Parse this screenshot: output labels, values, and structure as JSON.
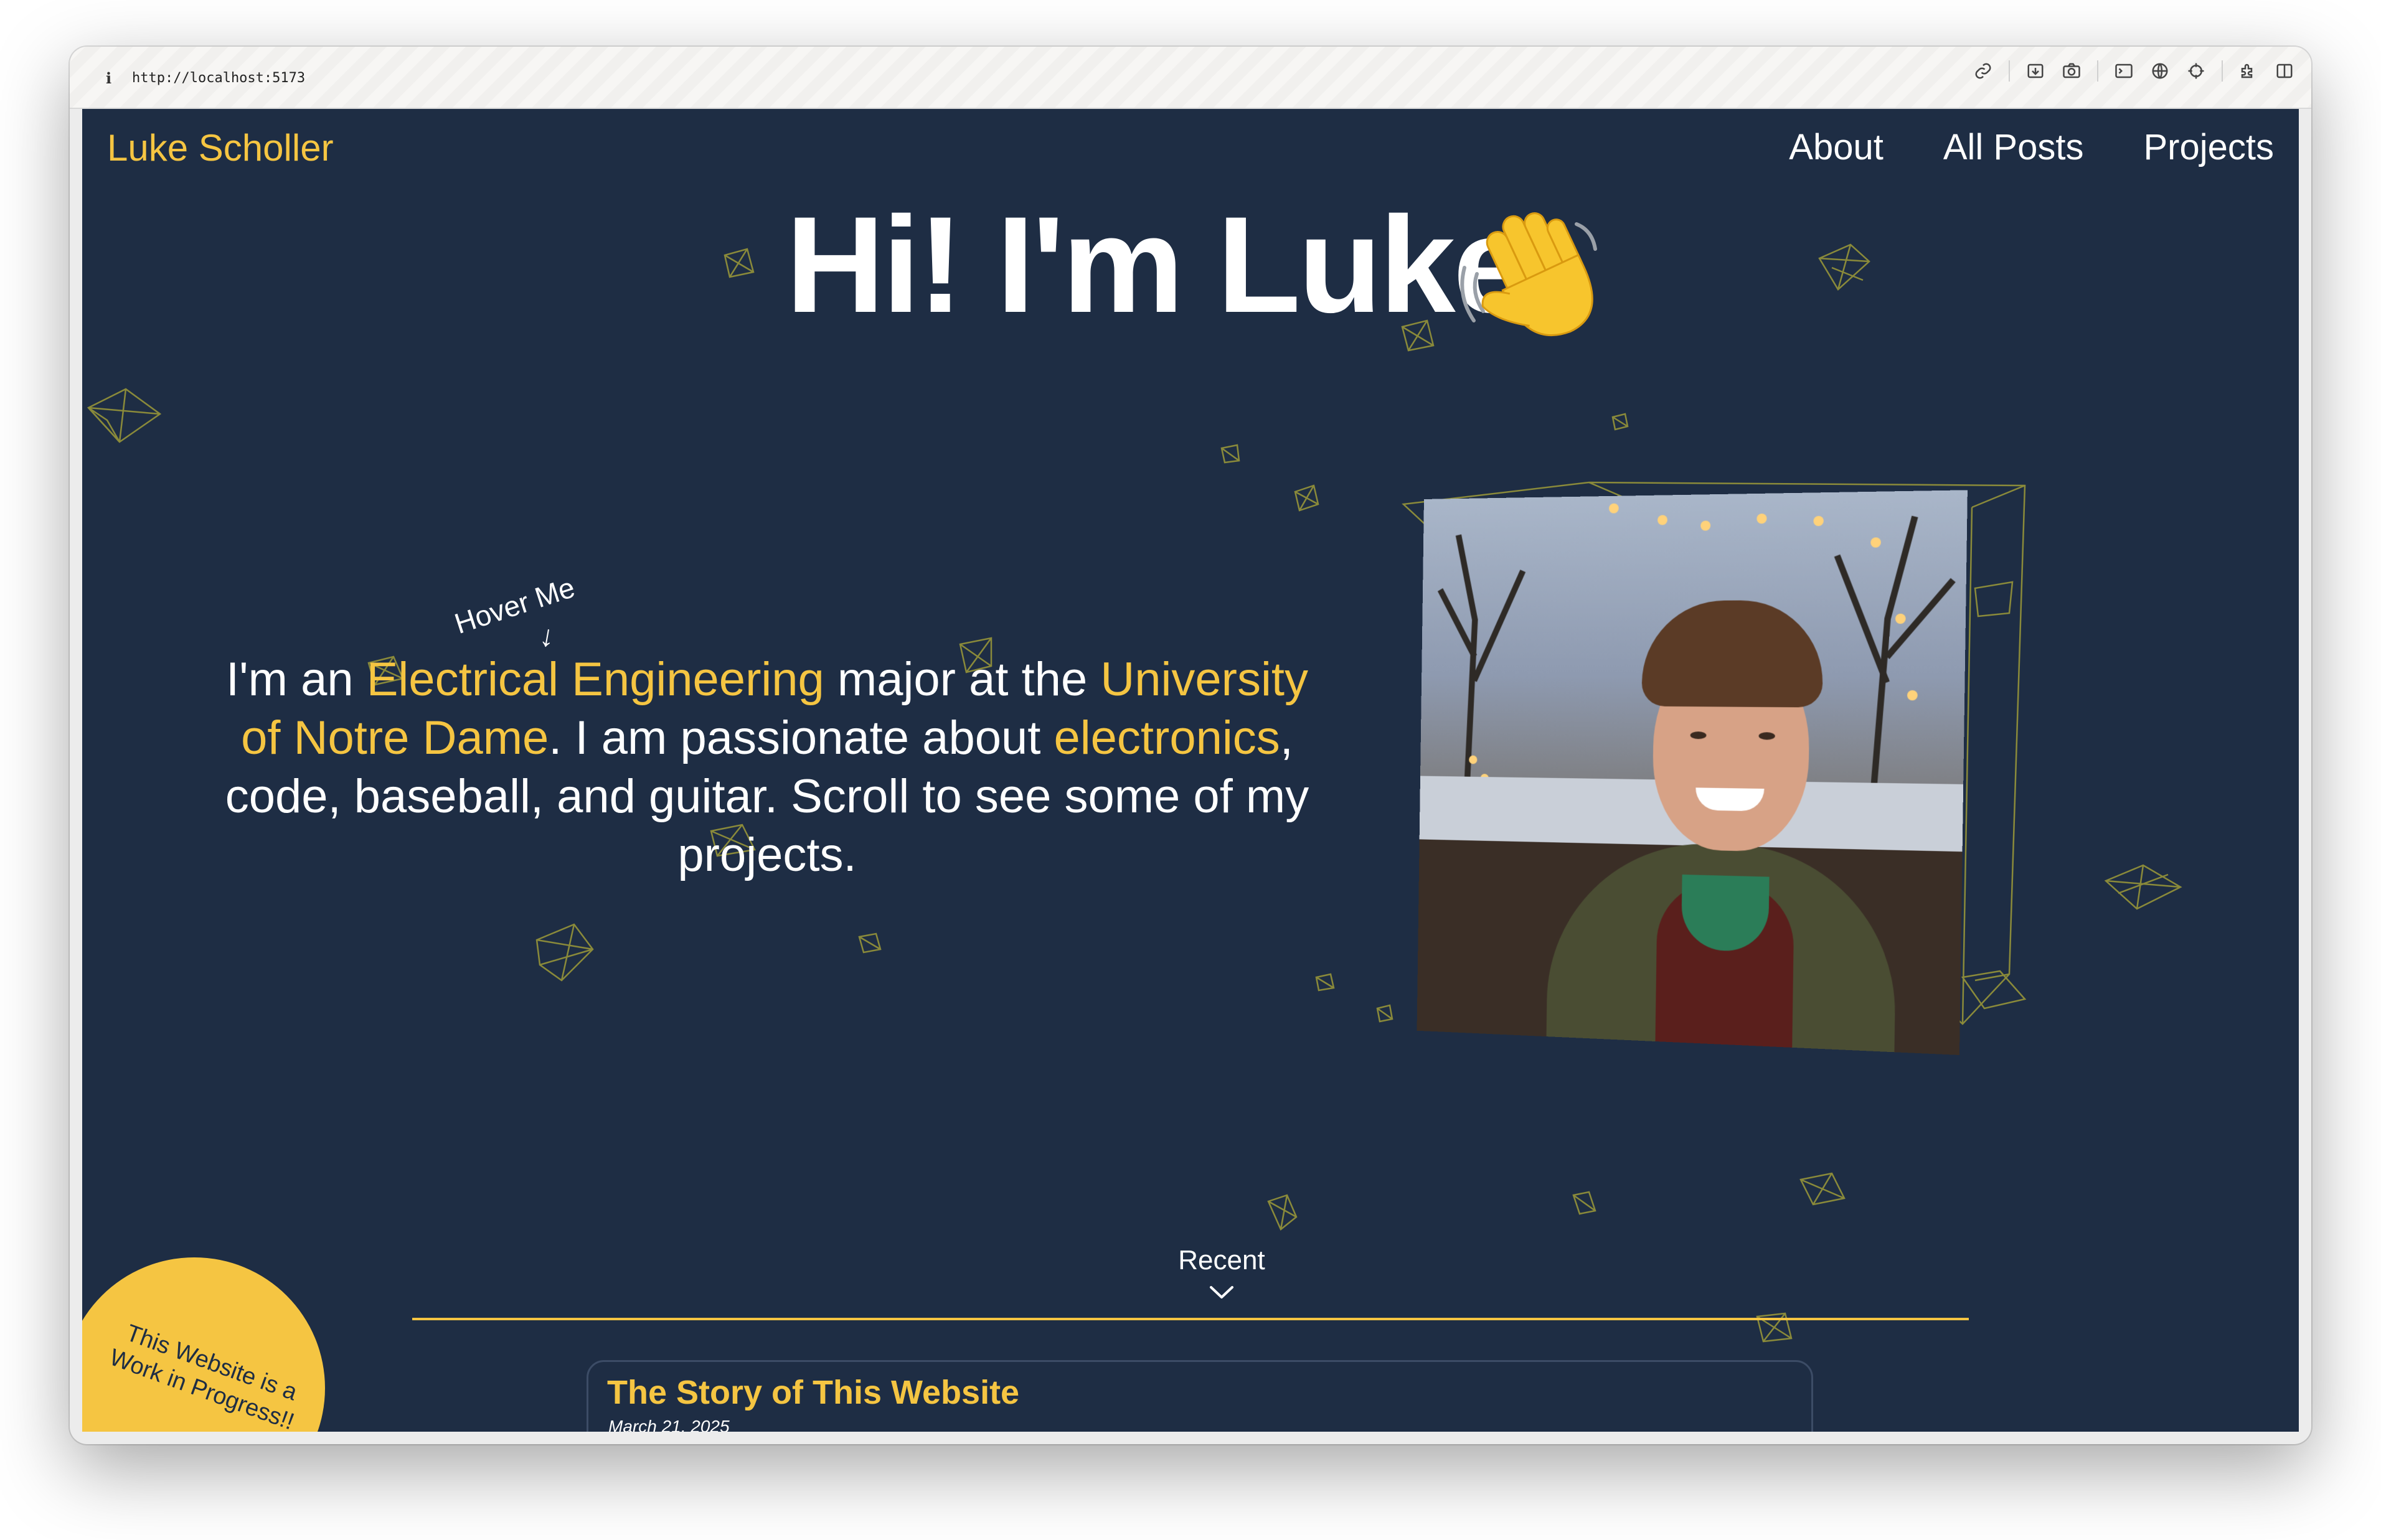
{
  "browser": {
    "url": "http://localhost:5173",
    "info_glyph": "i"
  },
  "site": {
    "brand": "Luke Scholler",
    "nav": [
      "About",
      "All Posts",
      "Projects"
    ]
  },
  "hero": {
    "title": "Hi! I'm Luke",
    "wave_emoji": "👋",
    "hover_hint": "Hover Me",
    "hover_arrow": "↓",
    "bio": {
      "t1": "I'm an ",
      "h1": "Electrical Engineering",
      "t2": " major at the ",
      "h2": "University of Notre Dame",
      "t3": ". I am passionate about ",
      "h3": "electronics",
      "t4": ", code, baseball, and guitar. Scroll to see some of my projects."
    }
  },
  "wip_badge": "This Website is a Work in Progress!!",
  "recent": {
    "label": "Recent",
    "posts": [
      {
        "title": "The Story of This Website",
        "date": "March 21, 2025"
      }
    ]
  },
  "colors": {
    "background": "#1e2d44",
    "accent": "#f5c542",
    "text": "#ffffff",
    "deco_line": "#8a8a3a"
  },
  "icons": {
    "toolbar": [
      "link-icon",
      "download-icon",
      "camera-icon",
      "terminal-icon",
      "globe-icon",
      "crosshair-icon",
      "extension-icon",
      "sidebar-icon"
    ]
  }
}
